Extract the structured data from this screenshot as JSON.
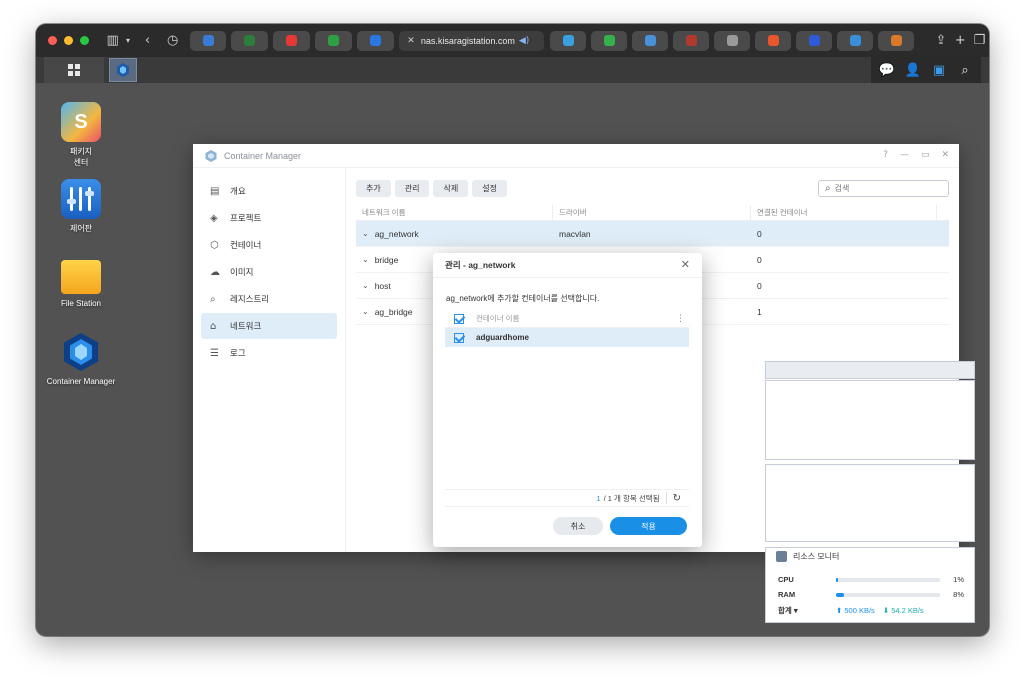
{
  "browser": {
    "url": "nas.kisaragistation.com",
    "tab_favicon_colors": [
      "#3a7bd5",
      "#2f7d3a",
      "#e53935",
      "#2ea043",
      "#2b78e4",
      "#3aa0e0",
      "#35b04a",
      "#4a90d9",
      "#b03a2e",
      "#9a9a9a",
      "#e8572b",
      "#2d5bd6",
      "#3b8ed9",
      "#d97a2b"
    ]
  },
  "desktop": {
    "icons": [
      {
        "label": "패키지\n센터",
        "name": "package-center-icon"
      },
      {
        "label": "제어판",
        "name": "control-panel-icon"
      },
      {
        "label": "File Station",
        "name": "file-station-icon"
      },
      {
        "label": "Container Manager",
        "name": "container-manager-icon"
      }
    ]
  },
  "app": {
    "title": "Container Manager",
    "sidebar": [
      {
        "label": "개요",
        "icon": "overview-icon",
        "glyph": "▤"
      },
      {
        "label": "프로젝트",
        "icon": "project-icon",
        "glyph": "◈"
      },
      {
        "label": "컨테이너",
        "icon": "container-icon",
        "glyph": "⬡"
      },
      {
        "label": "이미지",
        "icon": "image-icon",
        "glyph": "☁"
      },
      {
        "label": "레지스트리",
        "icon": "registry-icon",
        "glyph": "⌕"
      },
      {
        "label": "네트워크",
        "icon": "network-icon",
        "glyph": "⌂"
      },
      {
        "label": "로그",
        "icon": "log-icon",
        "glyph": "☰"
      }
    ],
    "toolbar": {
      "add": "추가",
      "manage": "관리",
      "delete": "삭제",
      "settings": "설정"
    },
    "search_placeholder": "검색",
    "table": {
      "headers": [
        "네트워크 이름",
        "드라이버",
        "연결된 컨테이너"
      ],
      "rows": [
        {
          "name": "ag_network",
          "driver": "macvlan",
          "count": "0"
        },
        {
          "name": "bridge",
          "driver": "",
          "count": "0"
        },
        {
          "name": "host",
          "driver": "",
          "count": "0"
        },
        {
          "name": "ag_bridge",
          "driver": "",
          "count": "1"
        }
      ]
    }
  },
  "modal": {
    "title": "관리 - ag_network",
    "description": "ag_network에 추가할 컨테이너를 선택합니다.",
    "column_header": "컨테이너 이름",
    "items": [
      {
        "name": "adguardhome",
        "checked": true
      }
    ],
    "selection_count": "1",
    "selection_total": "/ 1 개 항목 선택됨",
    "cancel": "취소",
    "apply": "적용"
  },
  "resource_monitor": {
    "title": "리소스 모니터",
    "cpu_label": "CPU",
    "cpu_pct": "1%",
    "cpu_value": 0.01,
    "ram_label": "RAM",
    "ram_pct": "8%",
    "ram_value": 0.08,
    "total_label": "합계",
    "upload": "500 KB/s",
    "download": "54.2 KB/s"
  }
}
